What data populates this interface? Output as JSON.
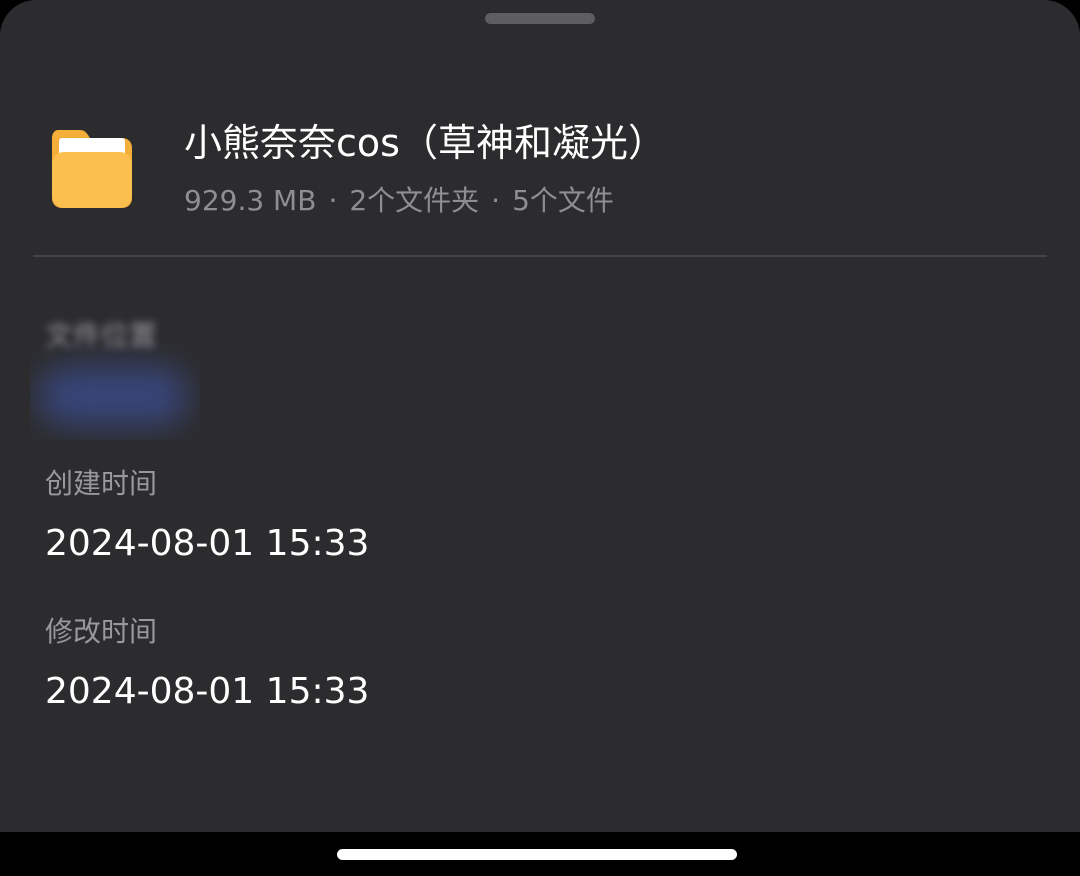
{
  "header": {
    "title": "小熊奈奈cos（草神和凝光）",
    "size": "929.3 MB",
    "separator": "·",
    "folder_count": "2个文件夹",
    "file_count": "5个文件",
    "icon": "folder-icon"
  },
  "fields": {
    "location": {
      "label": "文件位置",
      "value": ""
    },
    "created": {
      "label": "创建时间",
      "value": "2024-08-01 15:33"
    },
    "modified": {
      "label": "修改时间",
      "value": "2024-08-01 15:33"
    }
  },
  "colors": {
    "sheet_background": "#2c2c2e",
    "folder_body": "#fbbf50",
    "folder_tab": "#f4ae3a",
    "folder_paper": "#ffffff",
    "redacted_blob": "#3a4a86"
  }
}
